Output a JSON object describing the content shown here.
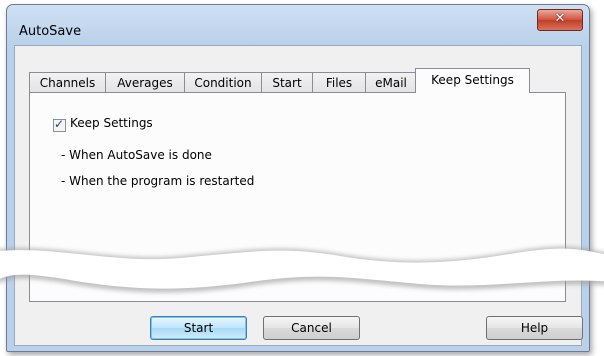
{
  "window": {
    "title": "AutoSave",
    "close_glyph": "✕",
    "close_icon": "close-icon"
  },
  "tabs": [
    {
      "label": "Channels"
    },
    {
      "label": "Averages"
    },
    {
      "label": "Condition"
    },
    {
      "label": "Start"
    },
    {
      "label": "Files"
    },
    {
      "label": "eMail"
    },
    {
      "label": "Keep Settings",
      "active": true
    }
  ],
  "keep_settings": {
    "checkbox_label": "Keep Settings",
    "checked": true,
    "check_glyph": "✓",
    "lines": [
      "- When AutoSave is done",
      "- When the program is restarted"
    ]
  },
  "buttons": {
    "start": "Start",
    "cancel": "Cancel",
    "help": "Help"
  },
  "colors": {
    "accent": "#3c7fb1",
    "close": "#c33d27",
    "frame": "#b9d1ea"
  }
}
